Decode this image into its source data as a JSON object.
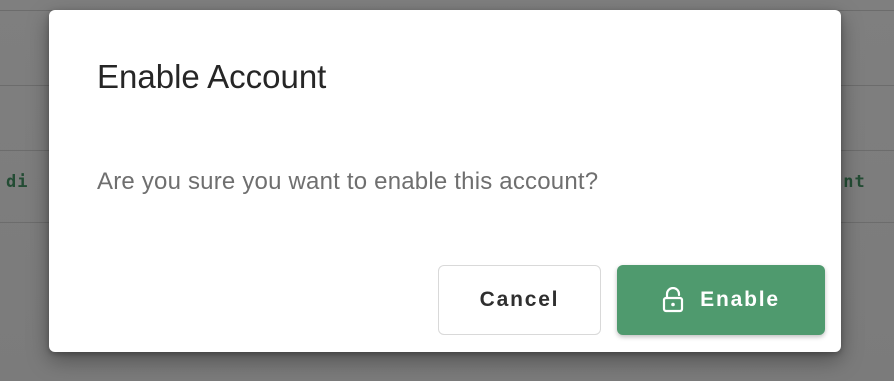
{
  "background": {
    "left_fragment": "di",
    "right_fragment": "unt"
  },
  "dialog": {
    "title": "Enable Account",
    "message": "Are you sure you want to enable this account?",
    "cancel_label": "Cancel",
    "confirm_label": "Enable",
    "confirm_icon": "unlock-icon"
  },
  "colors": {
    "confirm_button": "#4f9a6e",
    "overlay": "#7d7d7d",
    "dialog_background": "#ffffff"
  }
}
